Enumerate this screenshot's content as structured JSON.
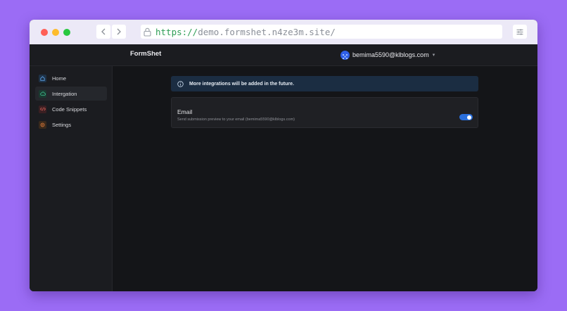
{
  "browser": {
    "url_scheme": "https://",
    "url_rest": "demo.formshet.n4ze3m.site/",
    "back_icon": "chevron-left-icon",
    "forward_icon": "chevron-right-icon",
    "lock_icon": "lock-icon",
    "tune_icon": "sliders-icon"
  },
  "header": {
    "brand": "FormShet",
    "user_email": "bemima5590@klblogs.com",
    "avatar_icon": "avatar-identicon",
    "caret_icon": "chevron-down-icon"
  },
  "sidebar": {
    "items": [
      {
        "label": "Home",
        "icon": "home-icon",
        "active": false,
        "color": "#5a9de0"
      },
      {
        "label": "Intergation",
        "icon": "cloud-icon",
        "active": true,
        "color": "#3fb88a"
      },
      {
        "label": "Code Snippets",
        "icon": "code-icon",
        "active": false,
        "color": "#e0645a"
      },
      {
        "label": "Settings",
        "icon": "gear-icon",
        "active": false,
        "color": "#e07a3a"
      }
    ]
  },
  "main": {
    "notice": {
      "icon": "info-icon",
      "text": "More integrations will be added in the future."
    },
    "email_card": {
      "title": "Email",
      "description": "Send submission preview to your email (bemima5590@klblogs.com)",
      "toggle_on": true
    }
  },
  "colors": {
    "page_bg": "#9b6cf5",
    "app_bg": "#141518",
    "panel_bg": "#1b1c20",
    "notice_bg": "#1b2d42",
    "toggle_on": "#2a6fdc"
  }
}
